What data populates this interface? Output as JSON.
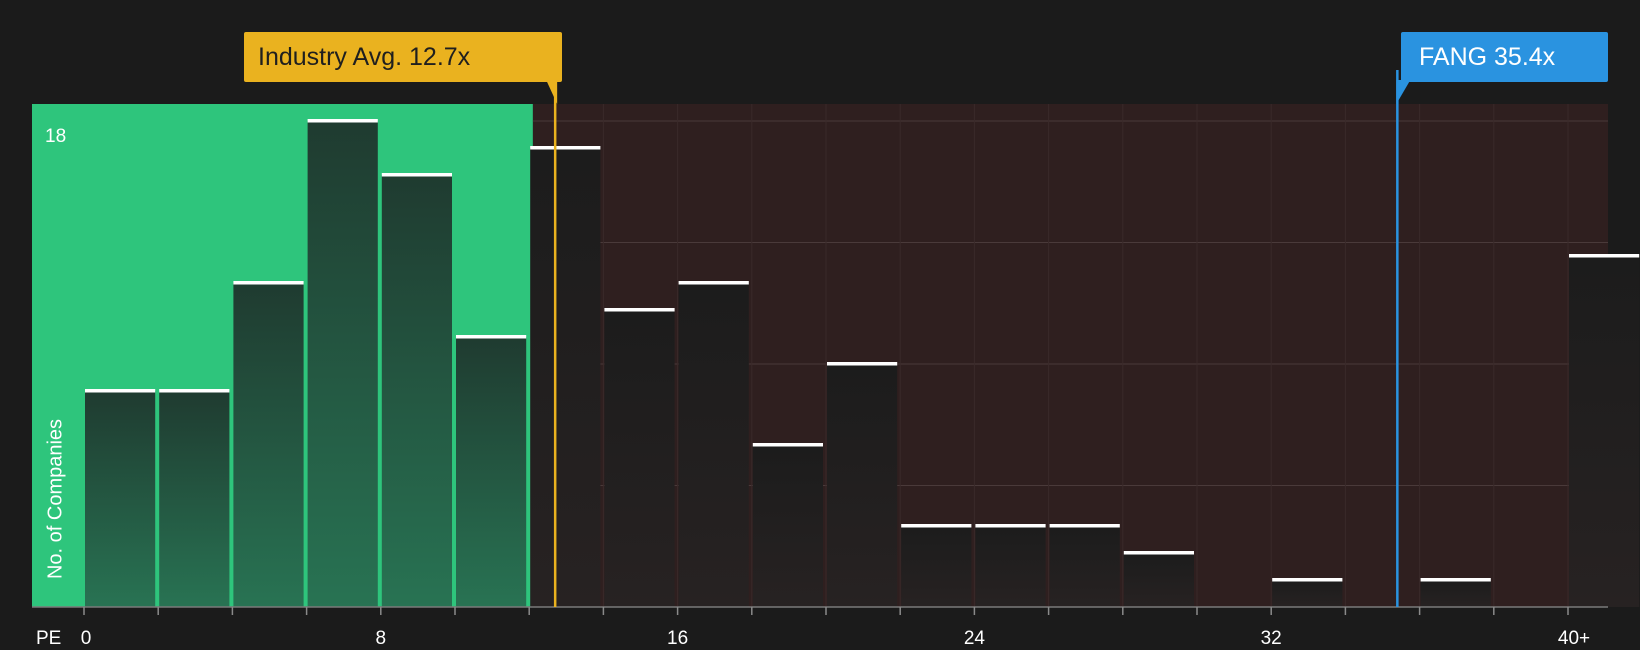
{
  "chart_data": {
    "type": "bar",
    "xlabel": "PE",
    "ylabel": "No. of Companies",
    "x_tick_labels": [
      "0",
      "8",
      "16",
      "24",
      "32",
      "40+"
    ],
    "x_tick_values": [
      0,
      8,
      16,
      24,
      32,
      40
    ],
    "y_tick_labels": [
      "18"
    ],
    "ylim": [
      0,
      18.6
    ],
    "bins": [
      {
        "x0": 0,
        "x1": 2,
        "value": 8
      },
      {
        "x0": 2,
        "x1": 4,
        "value": 8
      },
      {
        "x0": 4,
        "x1": 6,
        "value": 12
      },
      {
        "x0": 6,
        "x1": 8,
        "value": 18
      },
      {
        "x0": 8,
        "x1": 10,
        "value": 16
      },
      {
        "x0": 10,
        "x1": 12,
        "value": 10
      },
      {
        "x0": 12,
        "x1": 14,
        "value": 17
      },
      {
        "x0": 14,
        "x1": 16,
        "value": 11
      },
      {
        "x0": 16,
        "x1": 18,
        "value": 12
      },
      {
        "x0": 18,
        "x1": 20,
        "value": 6
      },
      {
        "x0": 20,
        "x1": 22,
        "value": 9
      },
      {
        "x0": 22,
        "x1": 24,
        "value": 3
      },
      {
        "x0": 24,
        "x1": 26,
        "value": 3
      },
      {
        "x0": 26,
        "x1": 28,
        "value": 3
      },
      {
        "x0": 28,
        "x1": 30,
        "value": 2
      },
      {
        "x0": 32,
        "x1": 34,
        "value": 1
      },
      {
        "x0": 36,
        "x1": 38,
        "value": 1
      },
      {
        "x0": 40,
        "x1": 42,
        "value": 13
      }
    ],
    "industry_avg": {
      "label": "Industry Avg. 12.7x",
      "value": 12.7
    },
    "company": {
      "label": "FANG 35.4x",
      "value": 35.4
    },
    "grid": true
  },
  "colors": {
    "background": "#1b1b1b",
    "fair_region": "#2ec57c",
    "expensive_region": "#2f1f1f",
    "industry": "#eab21f",
    "company": "#2a93e0",
    "bar_cap": "#ffffff"
  }
}
